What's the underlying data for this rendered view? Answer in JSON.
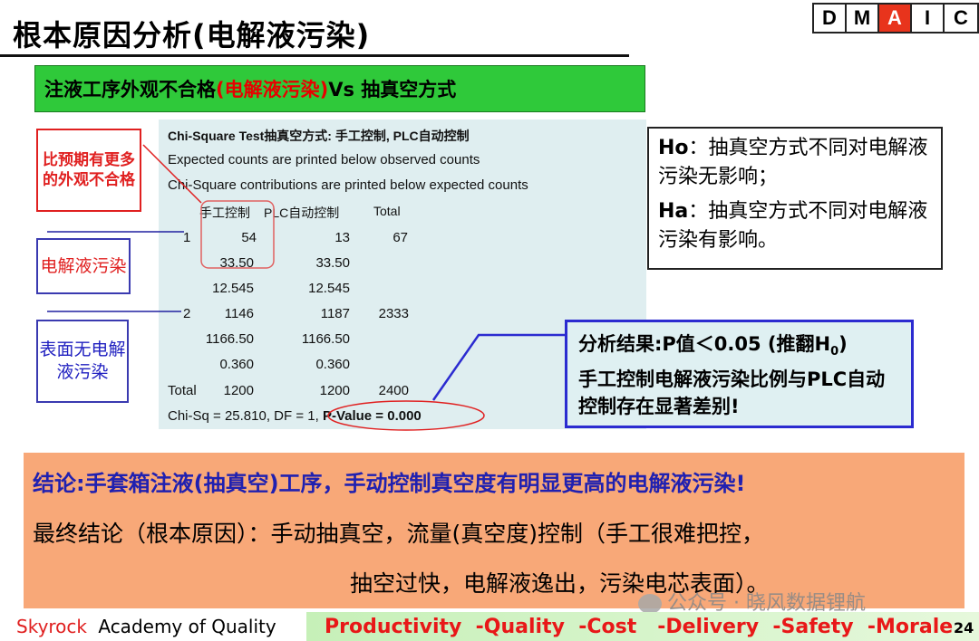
{
  "title": "根本原因分析(电解液污染)",
  "dmaic": [
    "D",
    "M",
    "A",
    "I",
    "C"
  ],
  "dmaic_active": "A",
  "green_bar": {
    "prefix": "注液工序外观不合格",
    "highlight": "(电解液污染)",
    "suffix": " Vs 抽真空方式"
  },
  "minitab": {
    "header": "Chi-Square Test抽真空方式: 手工控制, PLC自动控制",
    "line2": "Expected counts are printed below observed counts",
    "line3": "Chi-Square contributions are printed below expected counts",
    "columns": [
      "手工控制",
      "PLC自动控制",
      "Total"
    ],
    "row1_label": "1",
    "row1_obs": [
      "54",
      "13",
      "67"
    ],
    "row1_exp": [
      "33.50",
      "33.50"
    ],
    "row1_chi": [
      "12.545",
      "12.545"
    ],
    "row2_label": "2",
    "row2_obs": [
      "1146",
      "1187",
      "2333"
    ],
    "row2_exp": [
      "1166.50",
      "1166.50"
    ],
    "row2_chi": [
      "0.360",
      "0.360"
    ],
    "total_label": "Total",
    "totals": [
      "1200",
      "1200",
      "2400"
    ],
    "summary_prefix": "Chi-Sq = 25.810, DF = 1, ",
    "p_value": "P-Value = 0.000"
  },
  "red_box": "比预期有更多的外观不合格",
  "box_elec": "电解液污染",
  "box_surf": "表面无电解液污染",
  "hypothesis": {
    "ho_label": "Ho",
    "ho_text": "：抽真空方式不同对电解液污染无影响；",
    "ha_label": "Ha",
    "ha_text": "：抽真空方式不同对电解液污染有影响。"
  },
  "result": {
    "line1": "分析结果:P值＜0.05 (推翻H",
    "line1_sub": "0",
    "line1_end": ")",
    "line2": "手工控制电解液污染比例与PLC自动控制存在显著差别!"
  },
  "conclusion": {
    "line1": "结论:手套箱注液(抽真空)工序，手动控制真空度有明显更高的电解液污染!",
    "line2": "最终结论（根本原因）：手动抽真空，流量(真空度)控制（手工很难把控，",
    "line3": "抽空过快，电解液逸出，污染电芯表面）。"
  },
  "watermark": "公众号 · 晓风数据锂航",
  "footer": {
    "brand_red": "Skyrock",
    "brand_black": "Academy of Quality",
    "slogan": "Productivity  -Quality  -Cost   -Delivery  -Safety  -Morale",
    "page": "24"
  },
  "colors": {
    "accent_red": "#e02020",
    "accent_blue": "#2b2bd0",
    "green_bar": "#2fc93a",
    "conclusion_bg": "#f8a878",
    "minitab_bg": "#dfeef0"
  }
}
